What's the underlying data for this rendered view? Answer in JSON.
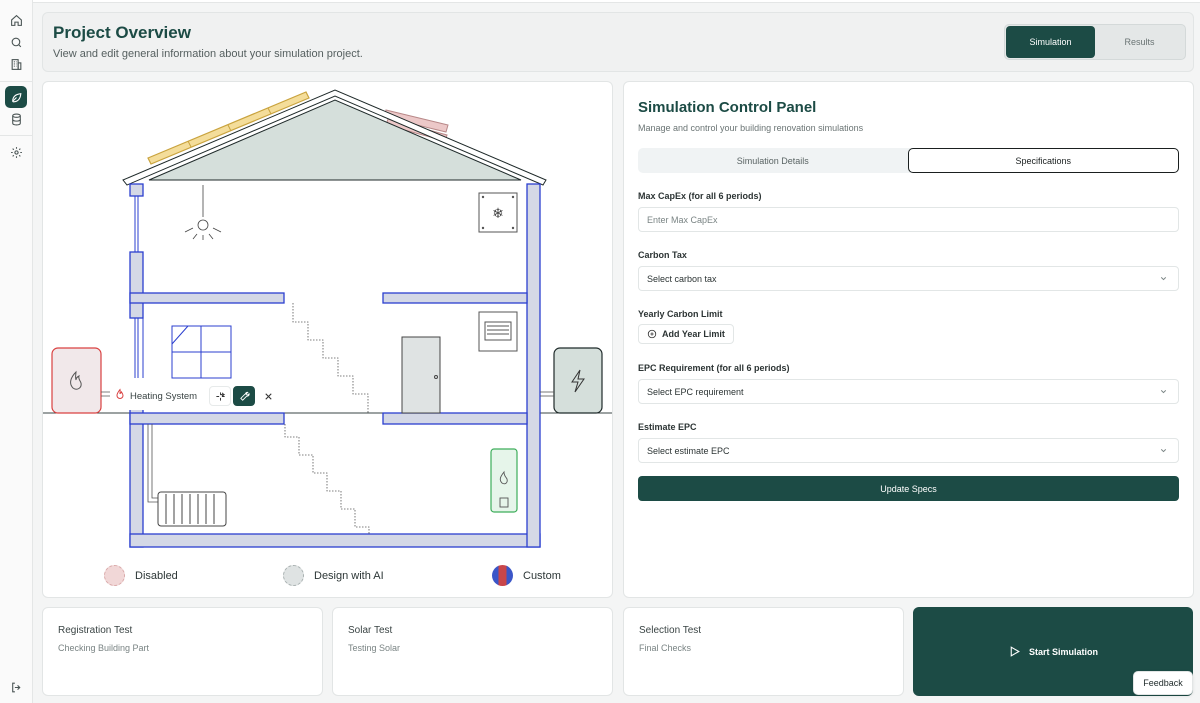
{
  "header": {
    "title": "Project Overview",
    "subtitle": "View and edit general information about your simulation project.",
    "tabs": [
      {
        "label": "Simulation",
        "active": true
      },
      {
        "label": "Results",
        "active": false
      }
    ]
  },
  "sidebar": {
    "icons": [
      "home-icon",
      "search-icon",
      "building-icon",
      "leaf-icon",
      "database-icon",
      "gear-icon",
      "logout-icon"
    ],
    "active": "leaf-icon"
  },
  "house": {
    "floating_bar": {
      "label": "Heating System"
    },
    "legend": [
      {
        "label": "Disabled",
        "color": "#f1d7d7"
      },
      {
        "label": "Design with AI",
        "color": "#dfe3e3"
      },
      {
        "label": "Custom",
        "color": "#c9464a"
      }
    ]
  },
  "panel": {
    "title": "Simulation Control Panel",
    "subtitle": "Manage and control your building renovation simulations",
    "tabs": [
      {
        "label": "Simulation Details",
        "active": false
      },
      {
        "label": "Specifications",
        "active": true
      }
    ],
    "fields": {
      "max_capex_label": "Max CapEx (for all 6 periods)",
      "max_capex_placeholder": "Enter Max CapEx",
      "carbon_tax_label": "Carbon Tax",
      "carbon_tax_value": "Select carbon tax",
      "yearly_limit_label": "Yearly Carbon Limit",
      "add_year_label": "Add Year Limit",
      "epc_req_label": "EPC Requirement (for all 6 periods)",
      "epc_req_value": "Select EPC requirement",
      "estimate_epc_label": "Estimate EPC",
      "estimate_epc_value": "Select estimate EPC"
    },
    "update_label": "Update Specs"
  },
  "cards": [
    {
      "title": "Registration Test",
      "subtitle": "Checking Building Part"
    },
    {
      "title": "Solar Test",
      "subtitle": "Testing Solar"
    },
    {
      "title": "Selection Test",
      "subtitle": "Final Checks"
    }
  ],
  "start_label": "Start Simulation",
  "feedback_label": "Feedback",
  "colors": {
    "accent": "#1c4b45",
    "wall": "#d4d8e6",
    "wall_stroke": "#2b3fcf"
  }
}
